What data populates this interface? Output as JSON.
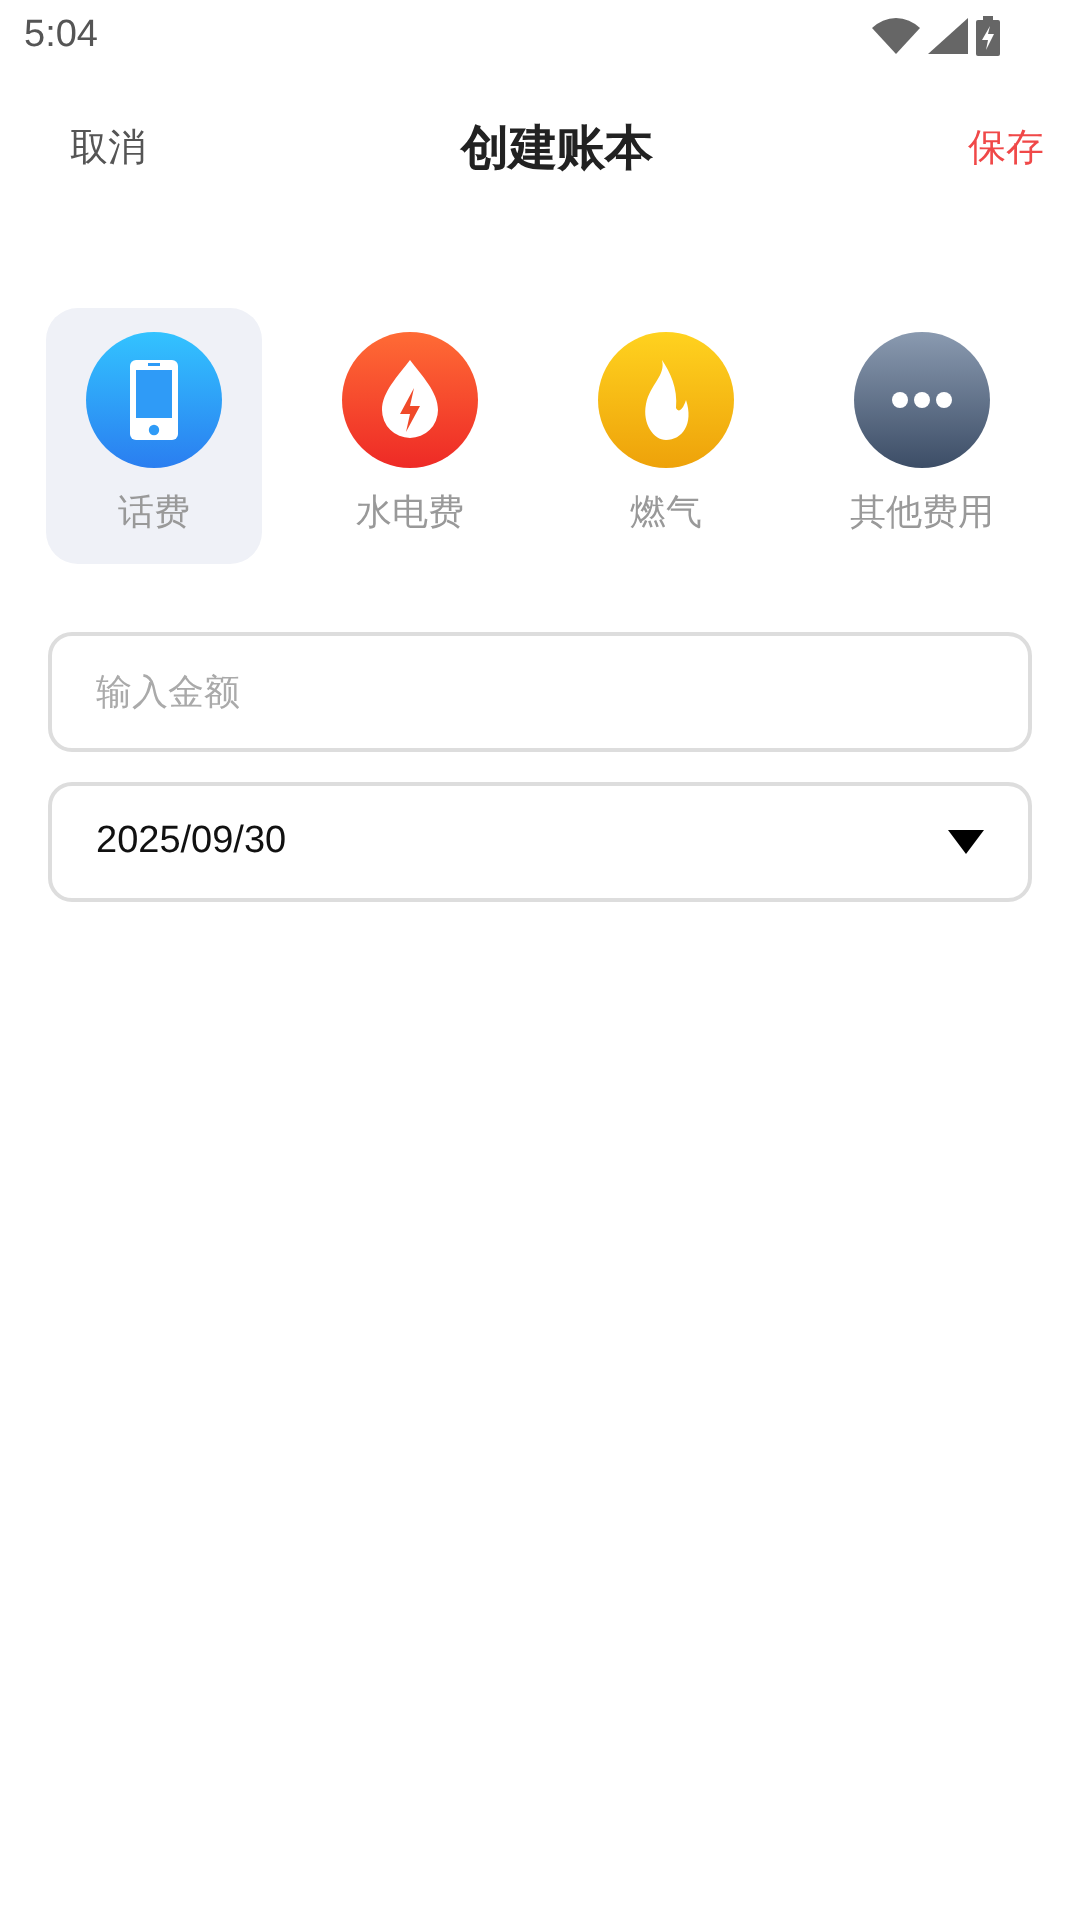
{
  "status_bar": {
    "time": "5:04"
  },
  "header": {
    "cancel": "取消",
    "title": "创建账本",
    "save": "保存"
  },
  "categories": [
    {
      "kind": "phone",
      "label": "话费",
      "selected": true
    },
    {
      "kind": "power",
      "label": "水电费",
      "selected": false
    },
    {
      "kind": "gas",
      "label": "燃气",
      "selected": false
    },
    {
      "kind": "more",
      "label": "其他费用",
      "selected": false
    }
  ],
  "amount_field": {
    "placeholder": "输入金额"
  },
  "date_field": {
    "value": "2025/09/30"
  }
}
